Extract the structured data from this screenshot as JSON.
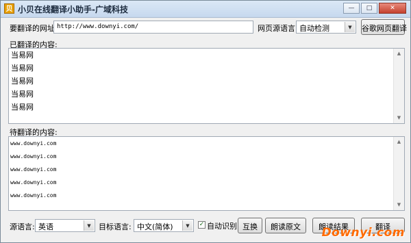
{
  "window": {
    "title": "小贝在线翻译小助手-广域科技",
    "icon_char": "贝",
    "min_glyph": "—",
    "max_glyph": "□",
    "close_glyph": "✕"
  },
  "url_row": {
    "label": "要翻译的网址:",
    "url_value": "http://www.downyi.com/",
    "source_lang_label": "网页源语言:",
    "source_lang_value": "自动检测",
    "google_button": "谷歌网页翻译"
  },
  "translated": {
    "label": "已翻译的内容:",
    "lines": [
      "当易网",
      "当易网",
      "当易网",
      "当易网",
      "当易网"
    ]
  },
  "pending": {
    "label": "待翻译的内容:",
    "lines": [
      "www.downyi.com",
      "www.downyi.com",
      "www.downyi.com",
      "www.downyi.com",
      "www.downyi.com"
    ]
  },
  "bottom": {
    "source_lang_label": "源语言:",
    "source_lang_value": "英语",
    "target_lang_label": "目标语言:",
    "target_lang_value": "中文(简体)",
    "auto_detect_label": "自动识别",
    "auto_detect_checked": true,
    "swap_button": "互换",
    "read_source_button": "朗读原文",
    "read_result_button": "朗读结果",
    "translate_button": "翻译"
  },
  "watermark": "Downyi.com"
}
